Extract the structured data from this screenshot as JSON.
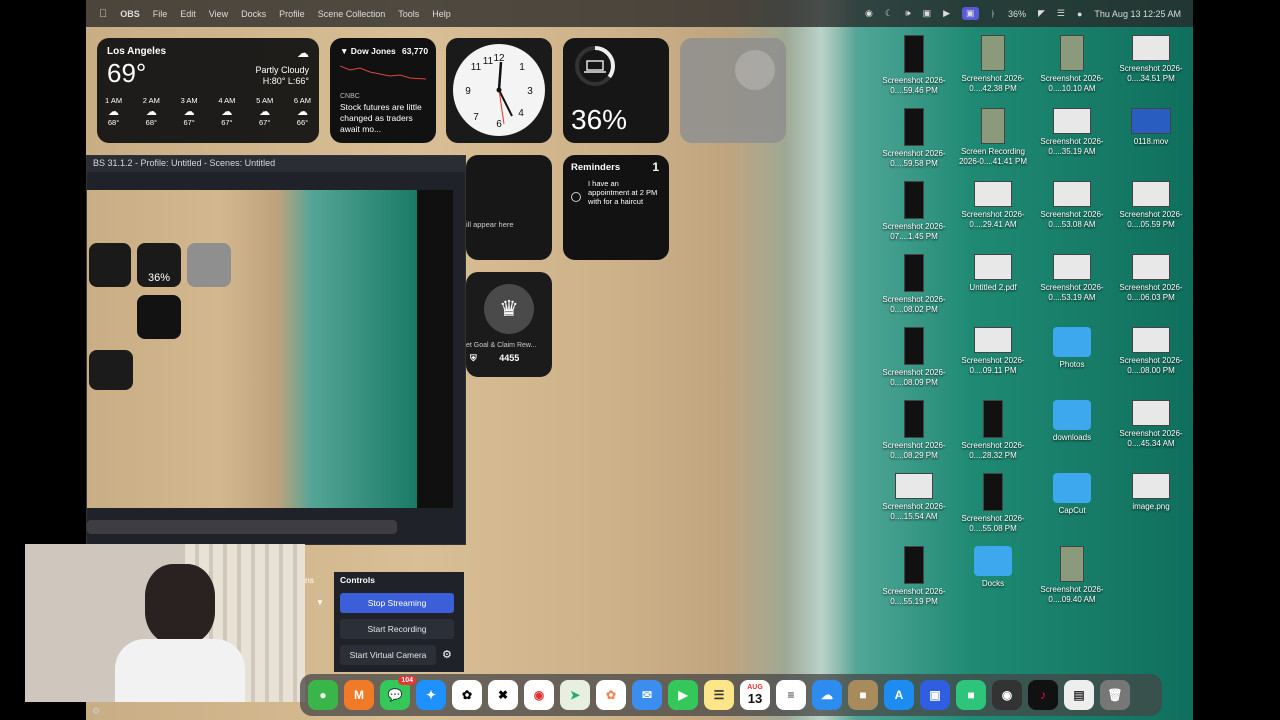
{
  "menubar": {
    "app_name": "OBS",
    "items": [
      "File",
      "Edit",
      "View",
      "Docks",
      "Profile",
      "Scene Collection",
      "Tools",
      "Help"
    ],
    "battery": "36%",
    "datetime": "Thu Aug 13  12:25 AM"
  },
  "weather": {
    "city": "Los Angeles",
    "temp": "69°",
    "condition": "Partly Cloudy",
    "hilo": "H:80° L:66°",
    "hours": [
      {
        "t": "1 AM",
        "v": "68°"
      },
      {
        "t": "2 AM",
        "v": "68°"
      },
      {
        "t": "3 AM",
        "v": "67°"
      },
      {
        "t": "4 AM",
        "v": "67°"
      },
      {
        "t": "5 AM",
        "v": "67°"
      },
      {
        "t": "6 AM",
        "v": "66°"
      }
    ]
  },
  "stocks": {
    "index": "Dow Jones",
    "value": "63,770",
    "source": "CNBC",
    "headline": "Stock futures are little changed as traders await mo..."
  },
  "battery_widget": {
    "value": "36%"
  },
  "reminders": {
    "title": "Reminders",
    "count": "1",
    "item": "I have an appointment at 2 PM with for a haircut"
  },
  "misc_widget": {
    "text": "ill appear here"
  },
  "game_widget": {
    "label": "et Goal & Claim Rew...",
    "score": "4455"
  },
  "obs": {
    "title": "BS 31.1.2 - Profile: Untitled - Scenes: Untitled",
    "controls_label": "Controls",
    "stop_streaming": "Stop Streaming",
    "start_recording": "Start Recording",
    "start_virtual_camera": "Start Virtual Camera",
    "partial_tab": "ns"
  },
  "desktop": [
    {
      "label": "Screenshot 2026-0....59.46 PM",
      "type": "phone"
    },
    {
      "label": "Screenshot 2026-0....42.38 PM",
      "type": "photo"
    },
    {
      "label": "Screenshot 2026-0....10.10 AM",
      "type": "photo"
    },
    {
      "label": "Screenshot 2026-0....34.51 PM",
      "type": "doc"
    },
    {
      "label": "Screenshot 2026-0....59.58 PM",
      "type": "phone"
    },
    {
      "label": "Screen Recording 2026-0....41.41 PM",
      "type": "photo"
    },
    {
      "label": "Screenshot 2026-0....35.19 AM",
      "type": "doc"
    },
    {
      "label": "0118.mov",
      "type": "video"
    },
    {
      "label": "Screenshot 2026-07....1.45 PM",
      "type": "phone"
    },
    {
      "label": "Screenshot 2026-0....29.41 AM",
      "type": "doc"
    },
    {
      "label": "Screenshot 2026-0....53.08 AM",
      "type": "doc"
    },
    {
      "label": "Screenshot 2026-0....05.59 PM",
      "type": "doc"
    },
    {
      "label": "Screenshot 2026-0....08.02 PM",
      "type": "phone"
    },
    {
      "label": "Untitled 2.pdf",
      "type": "doc"
    },
    {
      "label": "Screenshot 2026-0....53.19 AM",
      "type": "doc"
    },
    {
      "label": "Screenshot 2026-0....06.03 PM",
      "type": "doc"
    },
    {
      "label": "Screenshot 2026-0....08.09 PM",
      "type": "phone"
    },
    {
      "label": "Screenshot 2026-0....09.11 PM",
      "type": "doc"
    },
    {
      "label": "Photos",
      "type": "folder"
    },
    {
      "label": "Screenshot 2026-0....08.00 PM",
      "type": "doc"
    },
    {
      "label": "Screenshot 2026-0....08.29 PM",
      "type": "phone"
    },
    {
      "label": "Screenshot 2026-0....28.32 PM",
      "type": "phone"
    },
    {
      "label": "downloads",
      "type": "folder"
    },
    {
      "label": "Screenshot 2026-0....45.34 AM",
      "type": "doc"
    },
    {
      "label": "Screenshot 2026-0....15.54 AM",
      "type": "doc"
    },
    {
      "label": "Screenshot 2026-0....55.08 PM",
      "type": "phone"
    },
    {
      "label": "CapCut",
      "type": "folder"
    },
    {
      "label": "image.png",
      "type": "doc"
    },
    {
      "label": "Screenshot 2026-0....55.19 PM",
      "type": "phone"
    },
    {
      "label": "Docks",
      "type": "folder"
    },
    {
      "label": "Screenshot 2026-0....09.40 AM",
      "type": "photo"
    }
  ],
  "dock": {
    "messages_badge": "104",
    "calendar_month": "AUG",
    "calendar_day": "13"
  }
}
